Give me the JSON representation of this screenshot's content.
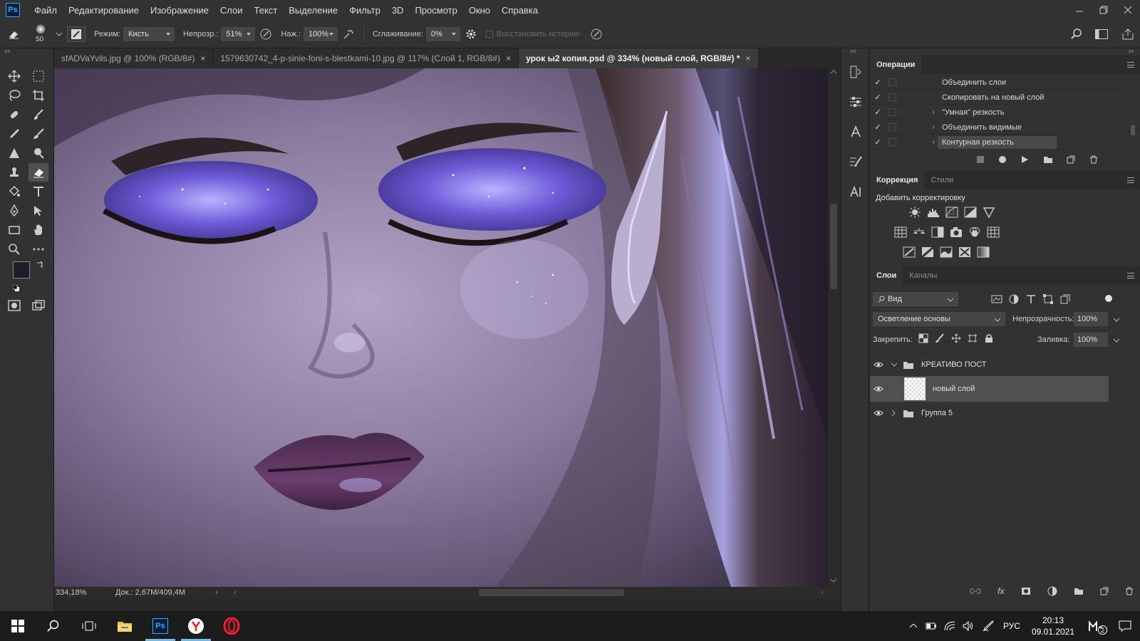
{
  "app": {
    "logo": "Ps",
    "menu": [
      "Файл",
      "Редактирование",
      "Изображение",
      "Слои",
      "Текст",
      "Выделение",
      "Фильтр",
      "3D",
      "Просмотр",
      "Окно",
      "Справка"
    ]
  },
  "options": {
    "brush_size": "50",
    "mode_label": "Режим:",
    "mode_value": "Кисть",
    "opacity_label": "Непрозр.:",
    "opacity_value": "51%",
    "pressure_label": "Наж.:",
    "pressure_value": "100%",
    "smoothing_label": "Сглаживание:",
    "smoothing_value": "0%",
    "restore_history": "Восстановить историю"
  },
  "tabs": [
    {
      "label": "sfADVaYvils.jpg @ 100% (RGB/8#)",
      "close": "×"
    },
    {
      "label": "1579630742_4-p-sinie-foni-s-blestkami-10.jpg @ 117% (Слой 1, RGB/8#)",
      "close": "×"
    },
    {
      "label": "урок ы2 копия.psd @ 334% (новый слой, RGB/8#) *",
      "close": "×"
    }
  ],
  "status": {
    "zoom": "334,18%",
    "doc": "Док.: 2,67M/409,4M"
  },
  "actions_panel": {
    "title": "Операции",
    "items": [
      {
        "label": "Объединить слои",
        "expandable": false
      },
      {
        "label": "Скопировать на новый слой",
        "expandable": false
      },
      {
        "label": "\"Умная\" резкость",
        "expandable": true
      },
      {
        "label": "Объединить видимые",
        "expandable": true
      },
      {
        "label": "Контурная резкость",
        "expandable": true
      }
    ]
  },
  "adjust_panel": {
    "tab1": "Коррекция",
    "tab2": "Стили",
    "add_label": "Добавить корректировку"
  },
  "layers_panel": {
    "tab1": "Слои",
    "tab2": "Каналы",
    "filter_kind": "Вид",
    "blend_mode": "Осветление основы",
    "opacity_label": "Непрозрачность:",
    "opacity_value": "100%",
    "lock_label": "Закрепить:",
    "fill_label": "Заливка:",
    "fill_value": "100%",
    "layers": [
      {
        "name": "КРЕАТИВО ПОСТ",
        "type": "group",
        "expanded": true
      },
      {
        "name": "новый слой",
        "type": "layer",
        "selected": true
      },
      {
        "name": "Группа 5",
        "type": "group",
        "expanded": false
      }
    ]
  },
  "taskbar": {
    "lang": "РУС",
    "time": "20:13",
    "date": "09.01.2021",
    "notif_count": "2"
  },
  "colors": {
    "accent": "#31a8ff",
    "foreground_swatch": "#1c1c2a",
    "background_swatch": "#2a2a3a"
  }
}
